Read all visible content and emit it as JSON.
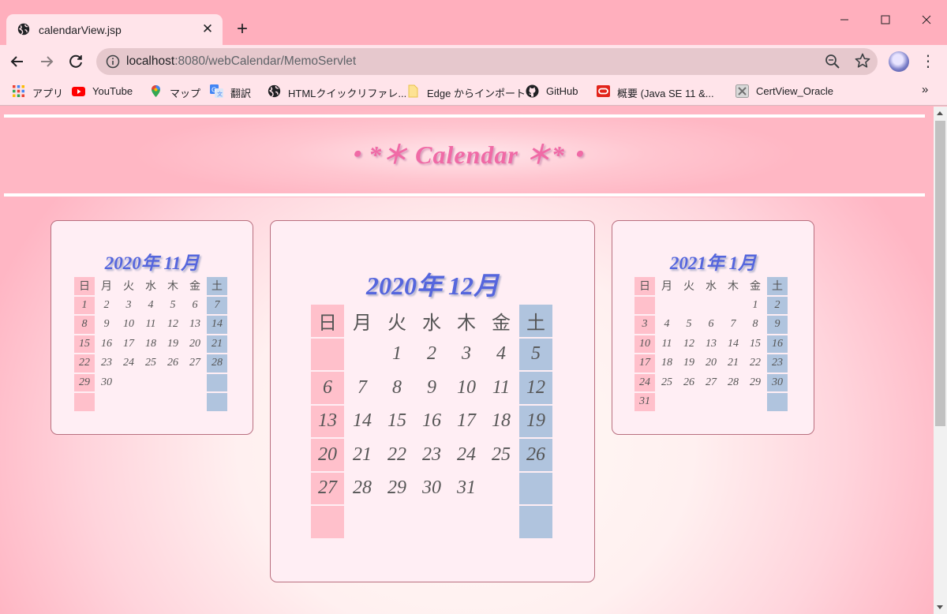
{
  "browser": {
    "tab_title": "calendarView.jsp",
    "url_host": "localhost",
    "url_rest": ":8080/webCalendar/MemoServlet",
    "bookmarks": [
      {
        "label": "アプリ",
        "icon": "apps-grid-icon"
      },
      {
        "label": "YouTube",
        "icon": "youtube-icon"
      },
      {
        "label": "マップ",
        "icon": "maps-pin-icon"
      },
      {
        "label": "翻訳",
        "icon": "translate-icon"
      },
      {
        "label": "HTMLクイックリファレ...",
        "icon": "globe-icon"
      },
      {
        "label": "Edge からインポート",
        "icon": "folder-icon"
      },
      {
        "label": "GitHub",
        "icon": "github-icon"
      },
      {
        "label": "概要 (Java SE 11 &...",
        "icon": "oracle-icon"
      },
      {
        "label": "CertView_Oracle",
        "icon": "certview-icon"
      }
    ],
    "bookmarks_overflow": "»"
  },
  "page": {
    "title": "・*＊ Calendar ＊*・"
  },
  "calendars": {
    "prev": {
      "title": "2020年 11月",
      "weekdays": [
        "日",
        "月",
        "火",
        "水",
        "木",
        "金",
        "土"
      ],
      "weeks": [
        [
          "1",
          "2",
          "3",
          "4",
          "5",
          "6",
          "7"
        ],
        [
          "8",
          "9",
          "10",
          "11",
          "12",
          "13",
          "14"
        ],
        [
          "15",
          "16",
          "17",
          "18",
          "19",
          "20",
          "21"
        ],
        [
          "22",
          "23",
          "24",
          "25",
          "26",
          "27",
          "28"
        ],
        [
          "29",
          "30",
          "",
          "",
          "",
          "",
          ""
        ],
        [
          "",
          "",
          "",
          "",
          "",
          "",
          ""
        ]
      ]
    },
    "current": {
      "title": "2020年 12月",
      "weekdays": [
        "日",
        "月",
        "火",
        "水",
        "木",
        "金",
        "土"
      ],
      "weeks": [
        [
          "",
          "",
          "1",
          "2",
          "3",
          "4",
          "5"
        ],
        [
          "6",
          "7",
          "8",
          "9",
          "10",
          "11",
          "12"
        ],
        [
          "13",
          "14",
          "15",
          "16",
          "17",
          "18",
          "19"
        ],
        [
          "20",
          "21",
          "22",
          "23",
          "24",
          "25",
          "26"
        ],
        [
          "27",
          "28",
          "29",
          "30",
          "31",
          "",
          ""
        ],
        [
          "",
          "",
          "",
          "",
          "",
          "",
          ""
        ]
      ]
    },
    "next": {
      "title": "2021年 1月",
      "weekdays": [
        "日",
        "月",
        "火",
        "水",
        "木",
        "金",
        "土"
      ],
      "weeks": [
        [
          "",
          "",
          "",
          "",
          "",
          "1",
          "2"
        ],
        [
          "3",
          "4",
          "5",
          "6",
          "7",
          "8",
          "9"
        ],
        [
          "10",
          "11",
          "12",
          "13",
          "14",
          "15",
          "16"
        ],
        [
          "17",
          "18",
          "19",
          "20",
          "21",
          "22",
          "23"
        ],
        [
          "24",
          "25",
          "26",
          "27",
          "28",
          "29",
          "30"
        ],
        [
          "31",
          "",
          "",
          "",
          "",
          "",
          ""
        ]
      ]
    }
  },
  "colors": {
    "sunday_bg": "#ffc0cb",
    "saturday_bg": "#b0c4de",
    "title_pink": "#f06aa6",
    "month_title_blue": "#5566dd"
  }
}
